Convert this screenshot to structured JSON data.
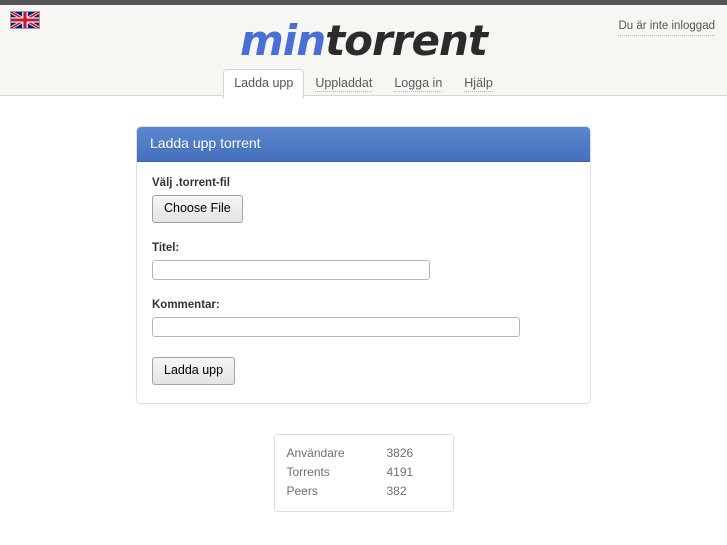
{
  "header": {
    "flag_icon": "uk-flag-icon",
    "login_status": "Du är inte inloggad",
    "logo_first": "min",
    "logo_second": "torrent"
  },
  "nav": {
    "tabs": [
      {
        "label": "Ladda upp",
        "active": true
      },
      {
        "label": "Uppladdat",
        "active": false
      },
      {
        "label": "Logga in",
        "active": false
      },
      {
        "label": "Hjälp",
        "active": false
      }
    ]
  },
  "panel": {
    "title": "Ladda upp torrent",
    "file_label": "Välj .torrent-fil",
    "file_button": "Choose File",
    "title_label": "Titel:",
    "title_value": "",
    "comment_label": "Kommentar:",
    "comment_value": "",
    "submit_label": "Ladda upp"
  },
  "stats": {
    "rows": [
      {
        "key": "Användare",
        "value": "3826"
      },
      {
        "key": "Torrents",
        "value": "4191"
      },
      {
        "key": "Peers",
        "value": "382"
      }
    ]
  },
  "colors": {
    "accent_blue": "#4570bd",
    "logo_blue": "#4a6fd4",
    "top_strip": "#565656",
    "header_bg": "#f6f6f2"
  }
}
